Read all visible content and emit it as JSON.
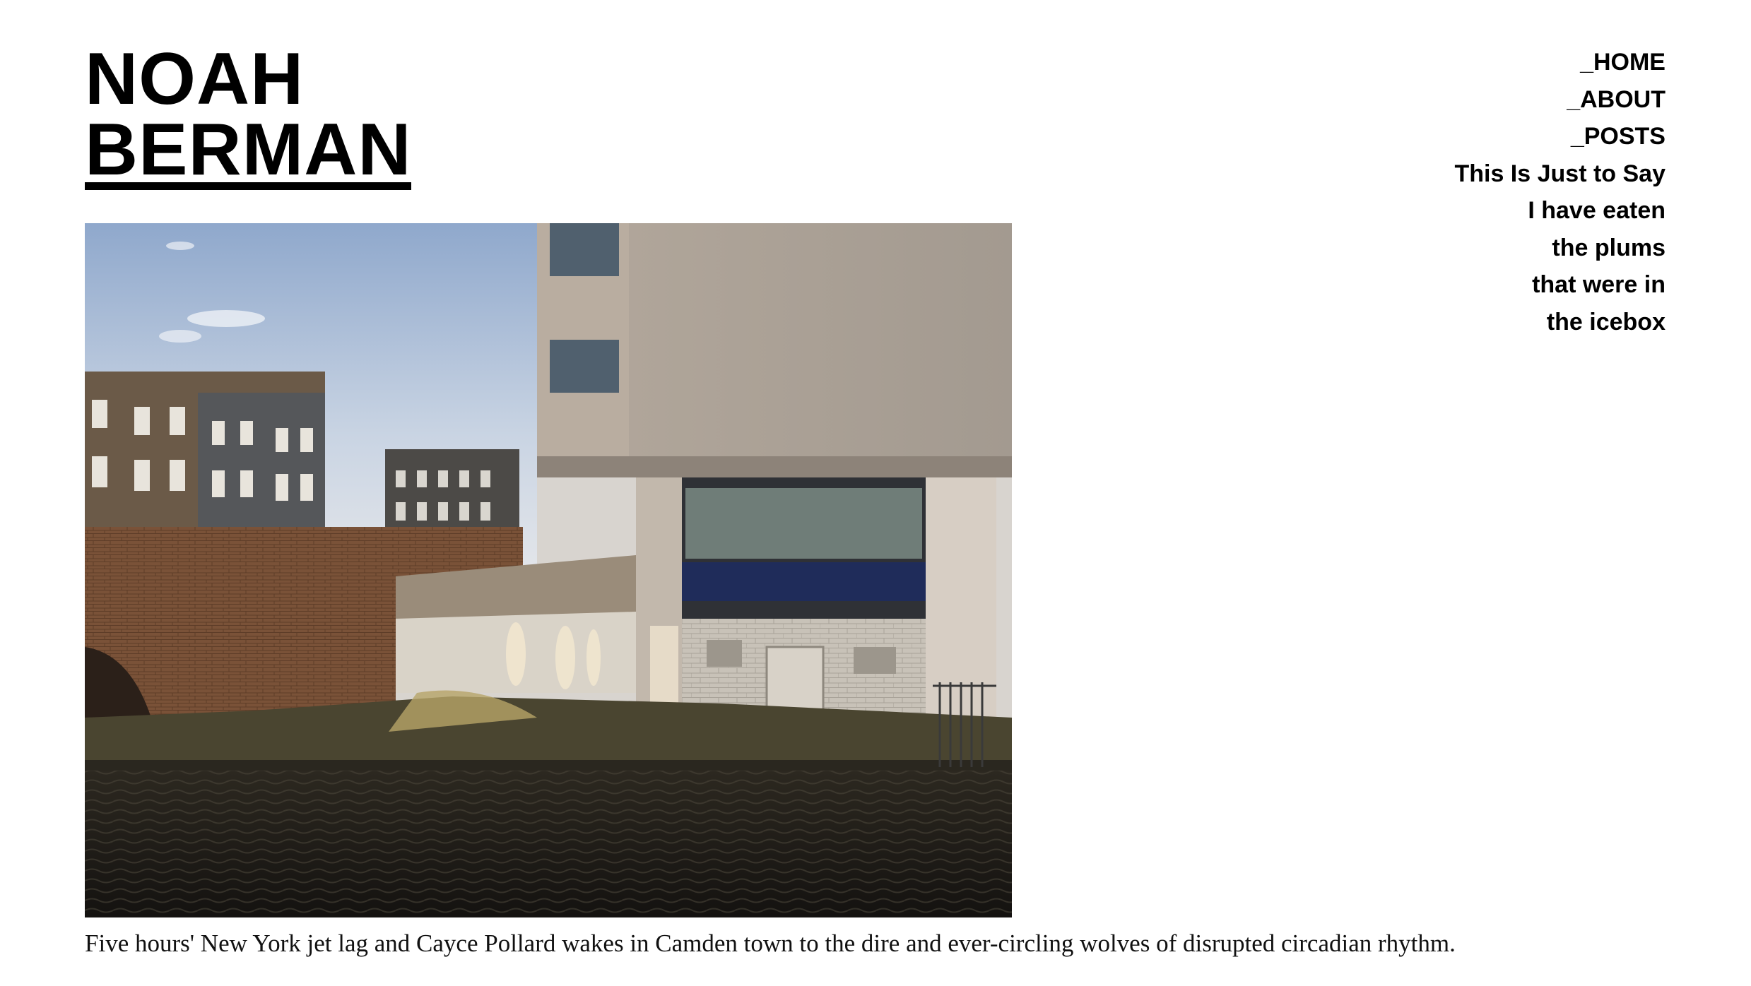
{
  "site": {
    "title_line1": "NOAH",
    "title_line2": "BERMAN"
  },
  "nav": {
    "items": [
      {
        "label": "_HOME"
      },
      {
        "label": "_ABOUT"
      },
      {
        "label": "_POSTS"
      }
    ],
    "poem": [
      "This Is Just to Say",
      "I have eaten",
      "the plums",
      "that were in",
      "the icebox"
    ]
  },
  "post": {
    "caption": "Five hours' New York jet lag and Cayce Pollard wakes in Camden town to the dire and ever-circling wolves of disrupted circadian rhythm."
  }
}
